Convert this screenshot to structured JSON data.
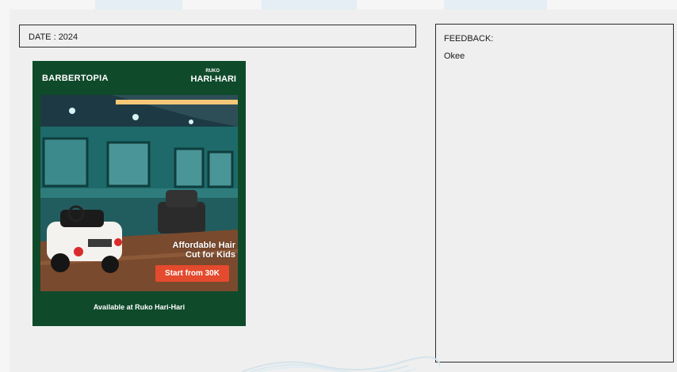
{
  "form": {
    "date_label": "DATE : 2024",
    "feedback_label": "FEEDBACK:",
    "feedback_value": "Okee"
  },
  "poster": {
    "brand": "BARBERTOPIA",
    "location_small": "RUKO",
    "location_big": "HARI-HARI",
    "headline_line1": "Affordable Hair",
    "headline_line2": "Cut for Kids",
    "price_badge": "Start from 30K",
    "footer": "Available at Ruko Hari-Hari",
    "colors": {
      "background": "#0f4a2b",
      "badge": "#e44a2d",
      "text": "#ffffff"
    }
  }
}
